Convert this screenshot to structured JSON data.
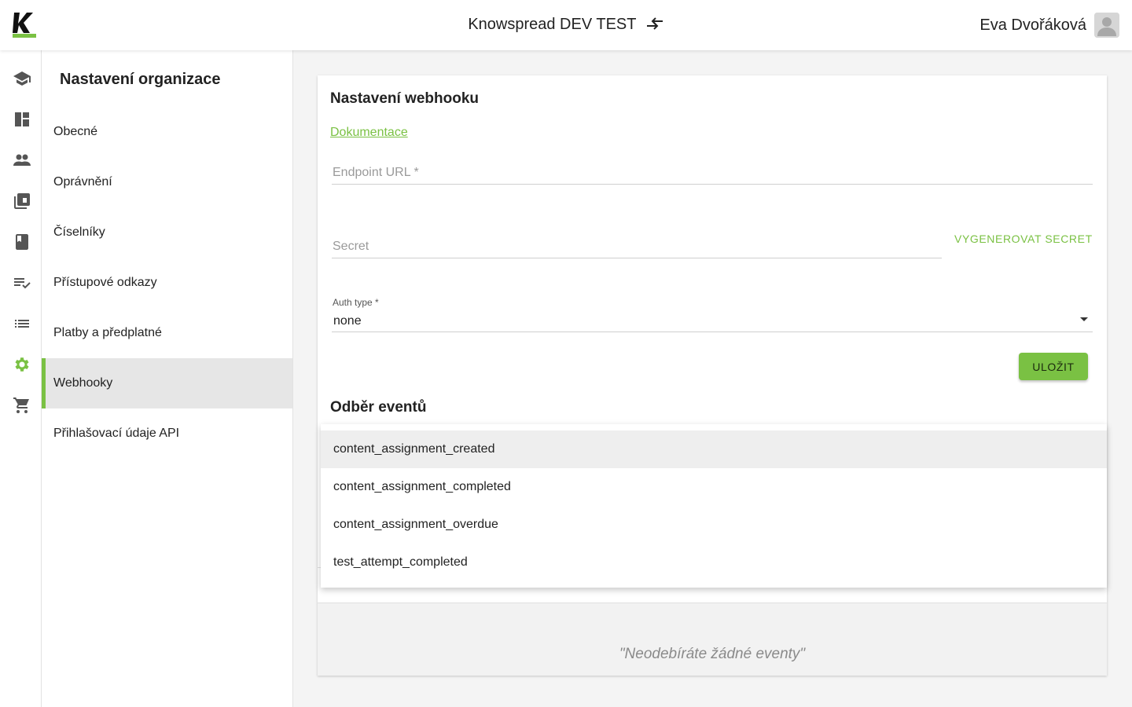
{
  "header": {
    "title": "Knowspread DEV TEST",
    "user_name": "Eva Dvořáková",
    "accent": "#7ac143"
  },
  "rail": {
    "icons": [
      "school-icon",
      "dashboard-icon",
      "people-icon",
      "library-icon",
      "book-icon",
      "playlist-check-icon",
      "list-icon",
      "settings-icon",
      "cart-icon"
    ],
    "active": "settings-icon"
  },
  "subnav": {
    "title": "Nastavení organizace",
    "items": [
      {
        "label": "Obecné"
      },
      {
        "label": "Oprávnění"
      },
      {
        "label": "Číselníky"
      },
      {
        "label": "Přístupové odkazy"
      },
      {
        "label": "Platby a předplatné"
      },
      {
        "label": "Webhooky",
        "active": true
      },
      {
        "label": "Přihlašovací údaje API"
      }
    ]
  },
  "webhook": {
    "title": "Nastavení webhooku",
    "doc_link": "Dokumentace",
    "endpoint_placeholder": "Endpoint URL *",
    "endpoint_value": "",
    "secret_placeholder": "Secret",
    "secret_value": "",
    "generate_secret_label": "VYGENEROVAT SECRET",
    "auth_type_label": "Auth type *",
    "auth_type_value": "none",
    "save_label": "ULOŽIT"
  },
  "events": {
    "title": "Odběr eventů",
    "dropdown_options": [
      "content_assignment_created",
      "content_assignment_completed",
      "content_assignment_overdue",
      "test_attempt_completed"
    ],
    "highlighted_option": "content_assignment_created",
    "empty_text": "\"Neodebíráte žádné eventy\""
  }
}
